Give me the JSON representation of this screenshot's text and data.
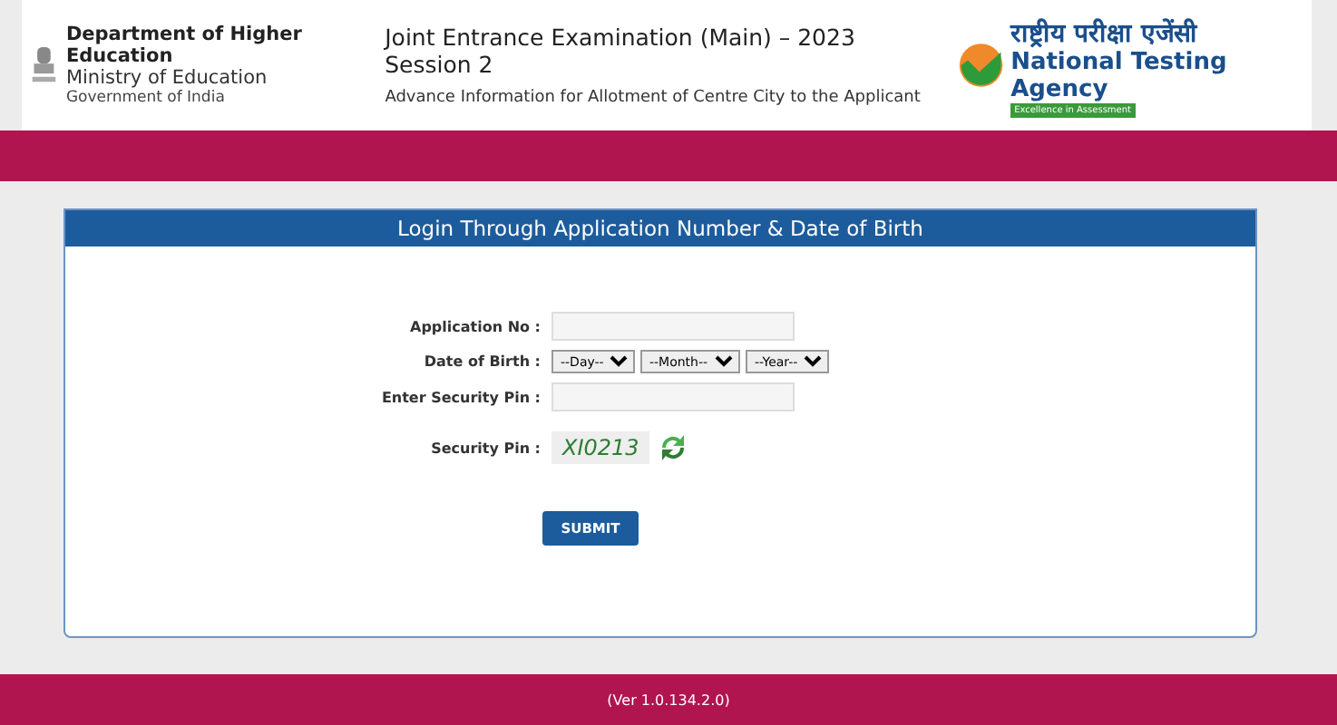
{
  "header": {
    "department": "Department of Higher Education",
    "ministry": "Ministry of Education",
    "government": "Government of India",
    "title": "Joint Entrance Examination (Main) – 2023 Session 2",
    "subtitle": "Advance Information for Allotment of Centre City to the Applicant",
    "agency_hindi": "राष्ट्रीय परीक्षा एजेंसी",
    "agency": "National Testing Agency",
    "tagline": "Excellence in Assessment"
  },
  "form": {
    "title": "Login Through Application Number & Date of Birth",
    "fields": [
      {
        "kind": "input",
        "label": "Application No :"
      },
      {
        "kind": "selects",
        "label": "Date of Birth :",
        "options": [
          "--Day--",
          "--Month--",
          "--Year--"
        ]
      },
      {
        "kind": "input",
        "label": "Enter Security Pin :"
      },
      {
        "kind": "captcha",
        "label": "Security Pin :",
        "code": "XI0213"
      }
    ],
    "submit": "SUBMIT"
  },
  "footer": {
    "version": "(Ver 1.0.134.2.0)"
  }
}
